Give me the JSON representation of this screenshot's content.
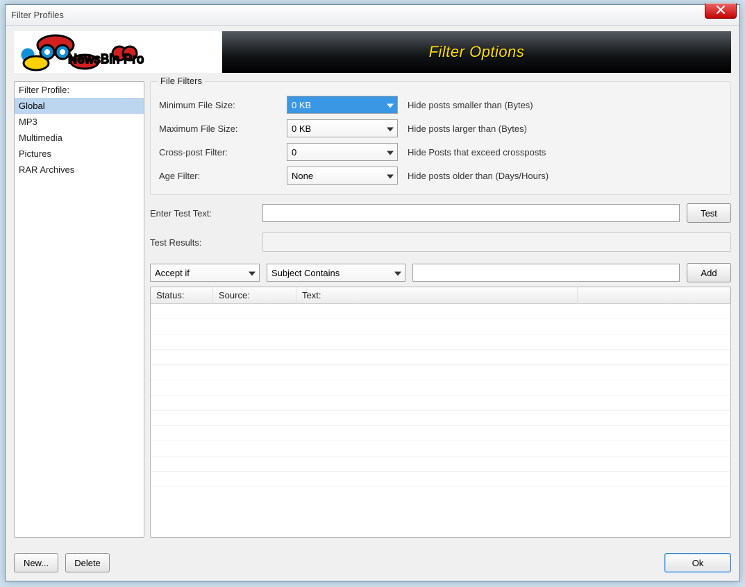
{
  "window": {
    "title": "Filter Profiles"
  },
  "banner": {
    "product": "NewsBin Pro",
    "caption": "Filter Options"
  },
  "sidebar": {
    "header": "Filter Profile:",
    "items": [
      "Global",
      "MP3",
      "Multimedia",
      "Pictures",
      "RAR Archives"
    ],
    "selected_index": 0
  },
  "group": {
    "legend": "File Filters",
    "min_label": "Minimum File Size:",
    "min_value": "0 KB",
    "min_hint": "Hide posts smaller than (Bytes)",
    "max_label": "Maximum File Size:",
    "max_value": "0 KB",
    "max_hint": "Hide posts larger than (Bytes)",
    "cross_label": "Cross-post Filter:",
    "cross_value": "0",
    "cross_hint": "Hide Posts that exceed crossposts",
    "age_label": "Age Filter:",
    "age_value": "None",
    "age_hint": "Hide posts older than (Days/Hours)"
  },
  "test": {
    "enter_label": "Enter Test Text:",
    "enter_value": "",
    "test_btn": "Test",
    "results_label": "Test Results:",
    "results_value": ""
  },
  "rule": {
    "accept_value": "Accept if",
    "field_value": "Subject Contains",
    "pattern_value": "",
    "add_btn": "Add"
  },
  "table": {
    "cols": {
      "status": "Status:",
      "source": "Source:",
      "text": "Text:",
      "extra": ""
    }
  },
  "footer": {
    "new_btn": "New...",
    "delete_btn": "Delete",
    "ok_btn": "Ok"
  }
}
